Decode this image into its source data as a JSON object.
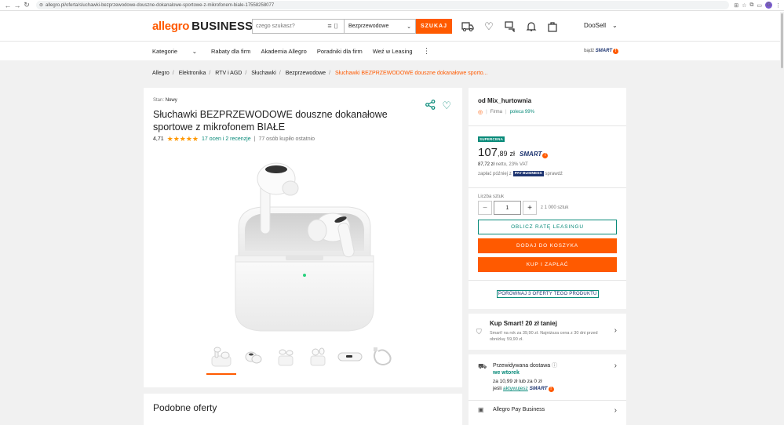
{
  "browser": {
    "url": "allegro.pl/oferta/sluchawki-bezprzewodowe-douszne-dokanalowe-sportowe-z-mikrofonem-biale-17558258077",
    "profile_initial": "G"
  },
  "header": {
    "logo_main": "allegro",
    "logo_biz": "BUSINESS",
    "search_placeholder": "czego szukasz?",
    "search_scope": "Bezprzewodowe",
    "search_button": "SZUKAJ",
    "account_name": "DooSell"
  },
  "nav": {
    "categories_label": "Kategorie",
    "items": [
      "Rabaty dla firm",
      "Akademia Allegro",
      "Poradniki dla firm",
      "Weź w Leasing"
    ],
    "smart_prefix": "bądź",
    "smart_label": "SMART"
  },
  "breadcrumb": [
    "Allegro",
    "Elektronika",
    "RTV i AGD",
    "Słuchawki",
    "Bezprzewodowe"
  ],
  "breadcrumb_current": "Słuchawki BEZPRZEWODOWE douszne dokanałowe sporto...",
  "product": {
    "condition_label": "Stan:",
    "condition_value": "Nowy",
    "title": "Słuchawki BEZPRZEWODOWE douszne dokanałowe sportowe z mikrofonem BIAŁE",
    "rating_value": "4,71",
    "rating_stars": 4.71,
    "rating_link": "17 ocen i 2 recenzje",
    "bought": "77 osób kupiło ostatnio",
    "similar_title": "Podobne oferty"
  },
  "buy": {
    "seller_prefix": "od",
    "seller_name": "Mix_hurtownia",
    "seller_type": "Firma",
    "recommend": "poleca 99%",
    "badge": "SUPERCENA",
    "price_int": "107",
    "price_cents": ",89",
    "price_currency": "zł",
    "smart_label": "SMART",
    "netto_value": "87,72 zł",
    "netto_text": "netto, 23% VAT",
    "pay_later_prefix": "zapłać później z",
    "pay_business": "PAY BUSINESS",
    "pay_later_suffix": "sprawdź",
    "qty_label": "Liczba sztuk",
    "qty_value": "1",
    "qty_of": "z 1 000 sztuk",
    "leasing_button": "OBLICZ RATĘ LEASINGU",
    "cart_button": "DODAJ DO KOSZYKA",
    "buy_button": "KUP I ZAPŁAĆ",
    "compare_link": "PORÓWNAJ 3 OFERTY TEGO PRODUKTU"
  },
  "smart_promo": {
    "title": "Kup Smart! 20 zł taniej",
    "desc": "Smart! na rok za 39,90 zł. Najniższa cena z 30 dni przed obniżką: 59,90 zł."
  },
  "delivery": {
    "label": "Przewidywana dostawa",
    "day": "we wtorek",
    "price": "za 10,99 zł lub za 0 zł",
    "smart_prefix": "jeśli",
    "smart_link": "aktywujesz",
    "smart_label": "SMART",
    "pay_business": "Allegro Pay Business"
  },
  "colors": {
    "accent": "#ff5a00",
    "teal": "#088a79",
    "navy": "#1d3470"
  }
}
